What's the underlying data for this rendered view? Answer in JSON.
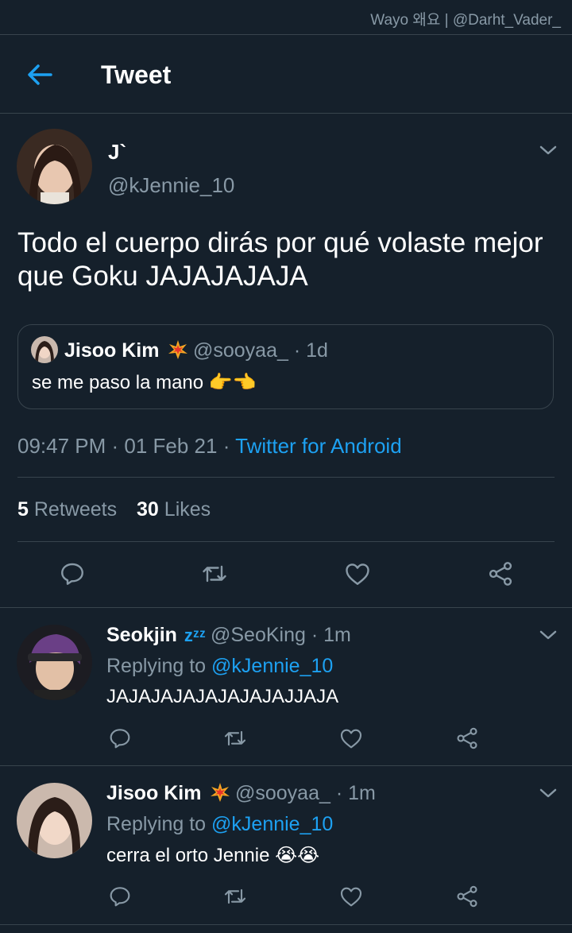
{
  "watermark": "Wayo 왜요 | @Darht_Vader_",
  "header": {
    "title": "Tweet"
  },
  "tweet": {
    "name": "J`",
    "handle": "@kJennie_10",
    "text": "Todo el cuerpo dirás por qué volaste mejor que Goku JAJAJAJAJA",
    "quote": {
      "name": "Jisoo Kim",
      "handle": "@sooyaa_ · 1d",
      "text": "se me paso la mano",
      "emoji": "👉👈"
    },
    "time": "09:47 PM · 01 Feb 21",
    "sep": " · ",
    "source": "Twitter for Android",
    "retweets_count": "5",
    "retweets_label": "Retweets",
    "likes_count": "30",
    "likes_label": "Likes"
  },
  "replies": [
    {
      "name": "Seokjin",
      "badge": "zᶻᶻ",
      "handle": "@SeoKing · 1m",
      "replying_label": "Replying to",
      "replying_to": "@kJennie_10",
      "text": "JAJAJAJAJAJAJAJAJJAJA"
    },
    {
      "name": "Jisoo Kim",
      "badge": "💥",
      "handle": "@sooyaa_ · 1m",
      "replying_label": "Replying to",
      "replying_to": "@kJennie_10",
      "text": "cerra el orto Jennie",
      "emoji": "😭😭"
    }
  ],
  "icons": [
    "back-arrow-icon",
    "chevron-down-icon",
    "reply-icon",
    "retweet-icon",
    "like-icon",
    "share-icon",
    "explosion-icon"
  ],
  "colors": {
    "background": "#15202b",
    "accent": "#1da1f2",
    "muted": "#8899a6",
    "divider": "#38444d"
  }
}
